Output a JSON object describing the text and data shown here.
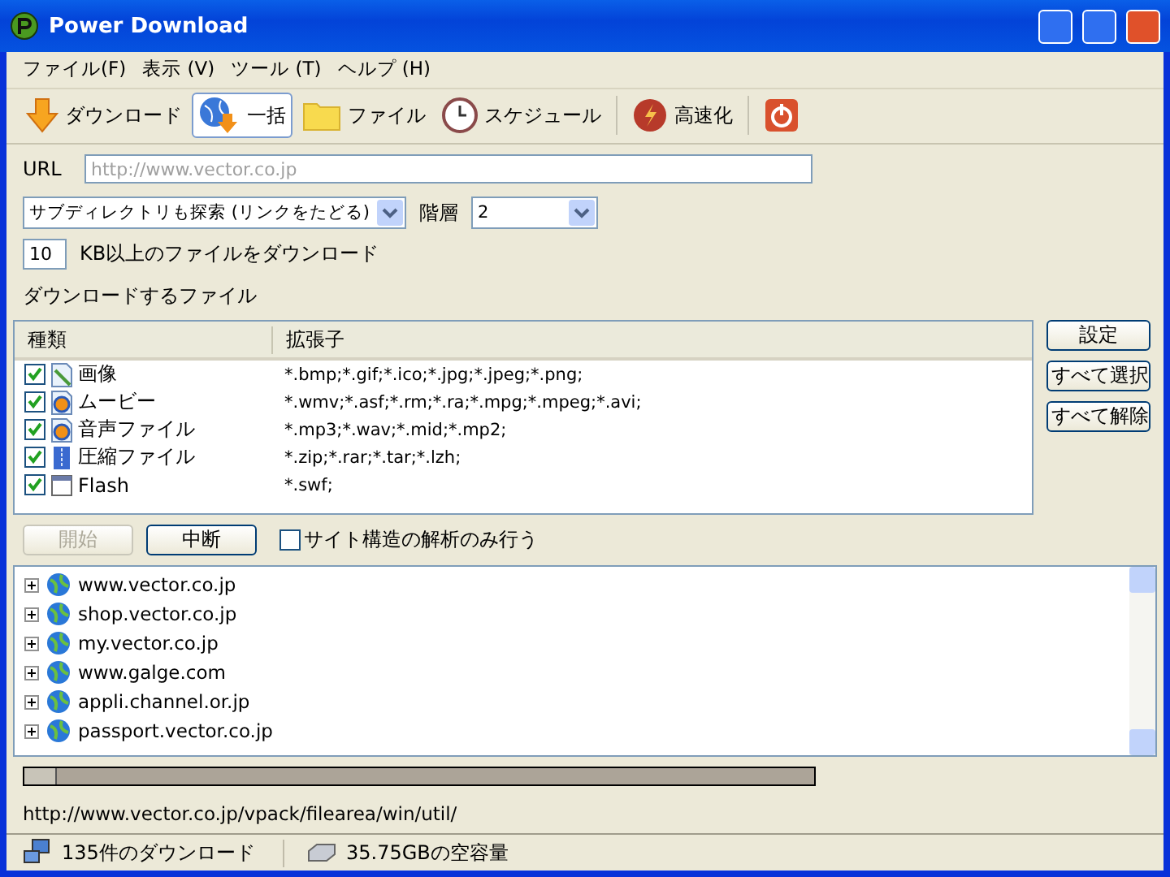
{
  "window": {
    "title": "Power Download"
  },
  "menu": [
    "ファイル(F)",
    "表示 (V)",
    "ツール (T)",
    "ヘルプ (H)"
  ],
  "toolbar": [
    {
      "kind": "download",
      "label": "ダウンロード",
      "selected": false
    },
    {
      "kind": "batch",
      "label": "一括",
      "selected": true
    },
    {
      "kind": "folder",
      "label": "ファイル",
      "selected": false
    },
    {
      "kind": "clock",
      "label": "スケジュール",
      "selected": false
    },
    {
      "kind": "speed",
      "label": "高速化",
      "selected": false
    },
    {
      "kind": "power",
      "selected": false
    }
  ],
  "url": {
    "label": "URL",
    "placeholder": "http://www.vector.co.jp"
  },
  "search_mode": {
    "value": "サブディレクトリも探索 (リンクをたどる)"
  },
  "depth": {
    "label": "階層",
    "value": "2"
  },
  "min_size": {
    "value": "10",
    "label": "KB以上のファイルをダウンロード"
  },
  "files_label": "ダウンロードするファイル",
  "file_table": {
    "columns": [
      "種類",
      "拡張子"
    ],
    "rows": [
      {
        "kind": "image",
        "type": "画像",
        "extensions": "*.bmp;*.gif;*.ico;*.jpg;*.jpeg;*.png;",
        "checked": true
      },
      {
        "kind": "media",
        "type": "ムービー",
        "extensions": "*.wmv;*.asf;*.rm;*.ra;*.mpg;*.mpeg;*.avi;",
        "checked": true
      },
      {
        "kind": "media",
        "type": "音声ファイル",
        "extensions": "*.mp3;*.wav;*.mid;*.mp2;",
        "checked": true
      },
      {
        "kind": "archive",
        "type": "圧縮ファイル",
        "extensions": "*.zip;*.rar;*.tar;*.lzh;",
        "checked": true
      },
      {
        "kind": "flash",
        "type": "Flash",
        "extensions": "*.swf;",
        "checked": true
      }
    ]
  },
  "side_buttons": [
    "設定",
    "すべて選択",
    "すべて解除"
  ],
  "actions": {
    "start": {
      "label": "開始",
      "disabled": true
    },
    "stop": {
      "label": "中断",
      "disabled": false
    },
    "analyze_only": {
      "label": "サイト構造の解析のみ行う",
      "checked": false
    }
  },
  "sites": [
    {
      "label": "www.vector.co.jp",
      "expanded": false
    },
    {
      "label": "shop.vector.co.jp",
      "expanded": false
    },
    {
      "label": "my.vector.co.jp",
      "expanded": false
    },
    {
      "label": "www.galge.com",
      "expanded": false
    },
    {
      "label": "appli.channel.or.jp",
      "expanded": false
    },
    {
      "label": "passport.vector.co.jp",
      "expanded": false
    }
  ],
  "progress": {
    "level": 0.04
  },
  "current_path": "http://www.vector.co.jp/vpack/filearea/win/util/",
  "status_bar": {
    "downloads": "135件のダウンロード",
    "free_space": "35.75GBの空容量"
  }
}
